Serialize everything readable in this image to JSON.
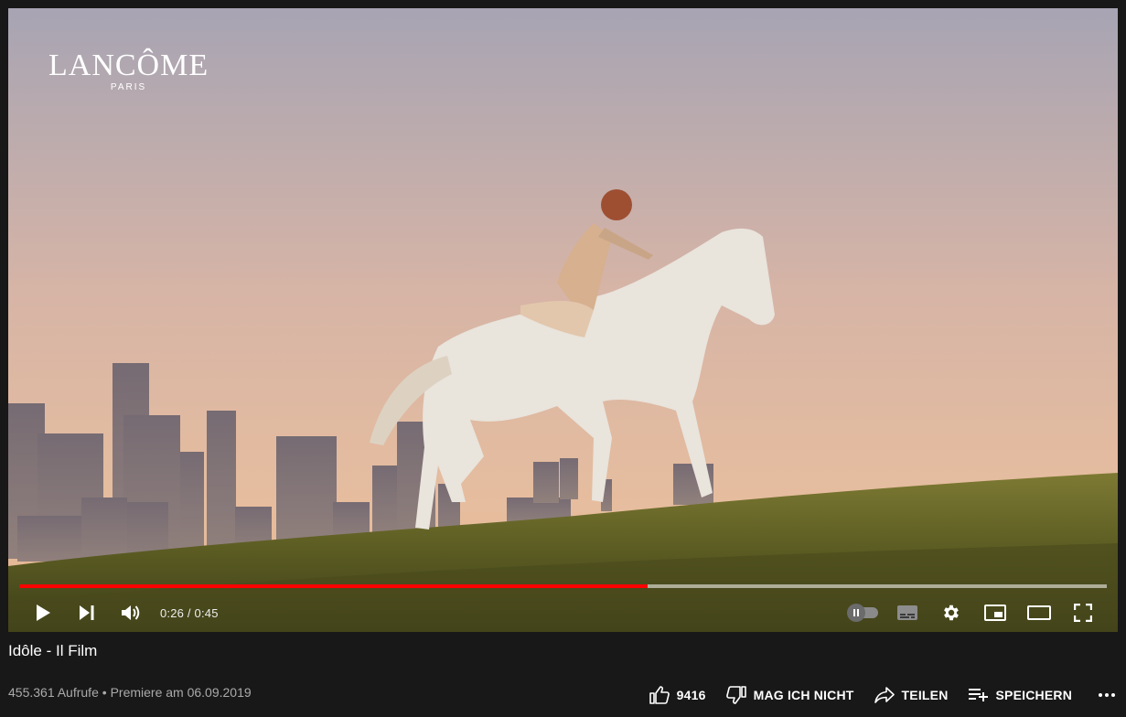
{
  "video": {
    "brand_name": "LANCÔME",
    "brand_sub": "PARIS",
    "progress_fraction": 0.578,
    "time": "0:26 / 0:45"
  },
  "controls": {
    "play_icon": "play-icon",
    "next_icon": "skip-next-icon",
    "volume_icon": "volume-icon",
    "autoplay_icon": "autoplay-toggle",
    "subtitles_icon": "subtitles-icon",
    "settings_icon": "gear-icon",
    "miniplayer_icon": "miniplayer-icon",
    "theater_icon": "theater-mode-icon",
    "fullscreen_icon": "fullscreen-icon"
  },
  "info": {
    "title": "Idôle - Il Film",
    "views": "455.361 Aufrufe",
    "separator": "•",
    "premiere": "Premiere am 06.09.2019"
  },
  "actions": {
    "likes": "9416",
    "dislike_label": "MAG ICH NICHT",
    "share_label": "TEILEN",
    "save_label": "SPEICHERN",
    "more_icon": "more-horiz-icon"
  },
  "colors": {
    "page_bg": "#181818",
    "progress_played": "#ff0000",
    "secondary_text": "#aaaaaa"
  }
}
